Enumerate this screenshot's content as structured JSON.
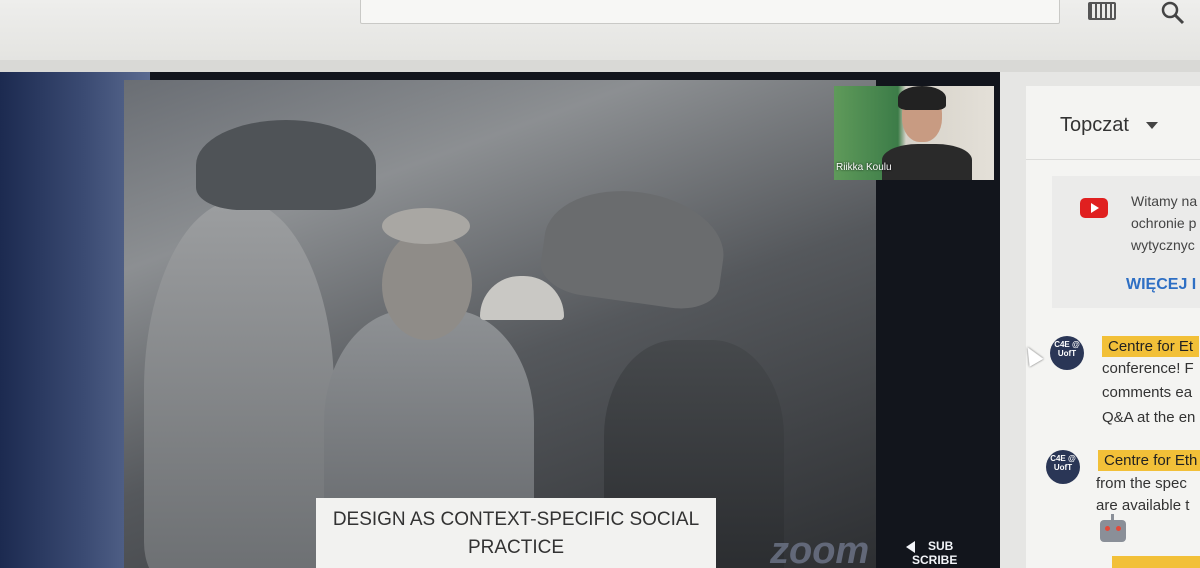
{
  "toolbar": {
    "keyboard_icon": "keyboard-icon",
    "search_icon": "search-icon"
  },
  "video": {
    "slide_caption_line1": "DESIGN AS CONTEXT-SPECIFIC SOCIAL",
    "slide_caption_line2": "PRACTICE",
    "speaker_name": "Riikka Koulu",
    "watermark": "zoom",
    "subscribe_line1": "SUB",
    "subscribe_line2": "SCRIBE"
  },
  "chat": {
    "title": "Topczat",
    "pinned": {
      "line1": "Witamy na",
      "line2": "ochronie p",
      "line3": "wytycznyc",
      "more_label": "WIĘCEJ I"
    },
    "messages": [
      {
        "avatar": "C4E @ UofT",
        "author": "Centre for Et",
        "lines": [
          "conference! F",
          "comments ea",
          "Q&A at the en"
        ]
      },
      {
        "avatar": "C4E @ UofT",
        "author": "Centre for Eth",
        "lines": [
          "from the spec",
          "are available t"
        ]
      }
    ]
  },
  "colors": {
    "author_highlight": "#f2c038",
    "link_blue": "#2e6fc4",
    "youtube_red": "#e02020"
  }
}
